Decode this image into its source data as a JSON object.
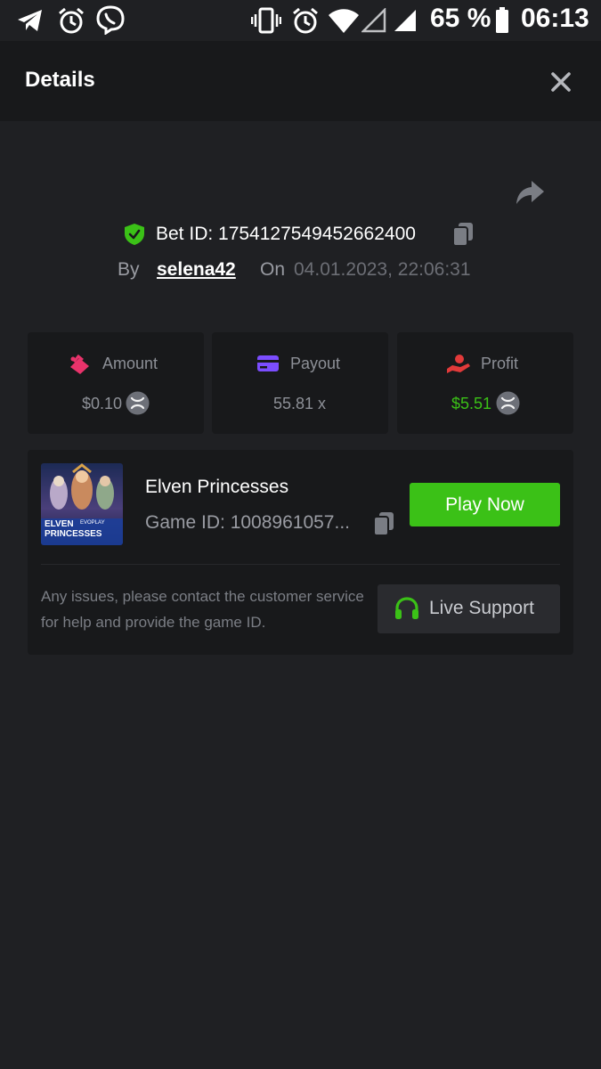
{
  "status_bar": {
    "battery": "65 %",
    "time": "06:13"
  },
  "header": {
    "title": "Details"
  },
  "bet": {
    "bet_id_text": "Bet ID: 1754127549452662400",
    "by_label": "By",
    "username": "selena42",
    "on_label": "On",
    "datetime": "04.01.2023, 22:06:31"
  },
  "stats": {
    "amount": {
      "label": "Amount",
      "value": "$0.10",
      "icon": "coins-icon",
      "color": "#e8336b"
    },
    "payout": {
      "label": "Payout",
      "value": "55.81 x",
      "icon": "card-icon",
      "color": "#7b4dff"
    },
    "profit": {
      "label": "Profit",
      "value": "$5.51",
      "icon": "hand-coin-icon",
      "color": "#e23a3a",
      "value_color": "#3bc117"
    }
  },
  "game": {
    "name": "Elven Princesses",
    "game_id_text": "Game ID: 1008961057...",
    "thumb_title": "ELVEN PRINCESSES",
    "thumb_brand": "EVOPLAY",
    "play_label": "Play Now",
    "help_text": "Any issues, please contact the customer service for help and provide the game ID.",
    "support_label": "Live Support"
  },
  "colors": {
    "accent_green": "#3bc117",
    "background": "#1f2023",
    "card": "#18191b"
  }
}
